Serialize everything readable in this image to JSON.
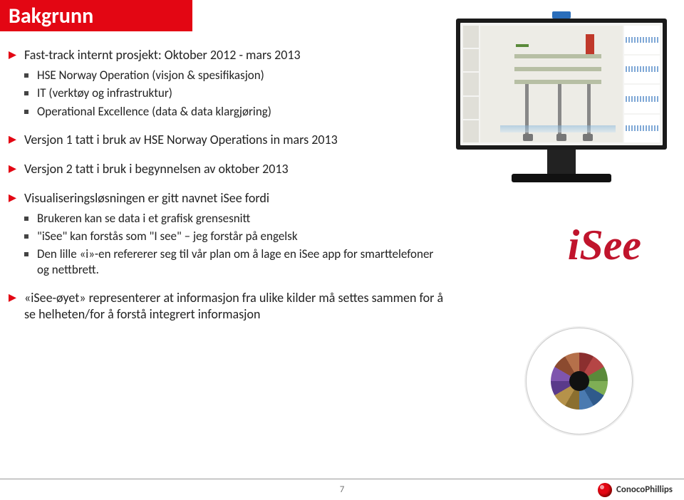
{
  "title": "Bakgrunn",
  "bullets": {
    "b1": "Fast-track internt prosjekt: Oktober 2012 - mars 2013",
    "b1a": "HSE Norway Operation (visjon & spesifikasjon)",
    "b1b": "IT (verktøy og infrastruktur)",
    "b1c": "Operational Excellence (data & data klargjøring)",
    "b2": "Versjon 1 tatt i bruk av HSE Norway Operations in mars 2013",
    "b3": "Versjon 2 tatt i bruk i begynnelsen av oktober 2013",
    "b4": "Visualiseringsløsningen er gitt navnet iSee fordi",
    "b4a": "Brukeren kan se data i et grafisk grensesnitt",
    "b4b": "\"iSee\" kan forstås som \"I see\" – jeg forstår på engelsk",
    "b4c": "Den lille «i»-en refererer seg til vår plan om å lage en iSee app for smarttelefoner og nettbrett.",
    "b5": "«iSee-øyet» representerer at informasjon fra ulike kilder må settes sammen for å se helheten/for å forstå integrert informasjon"
  },
  "logo_text": "iSee",
  "eye_label": "isee-eye",
  "page_number": "7",
  "brand": "ConocoPhillips"
}
